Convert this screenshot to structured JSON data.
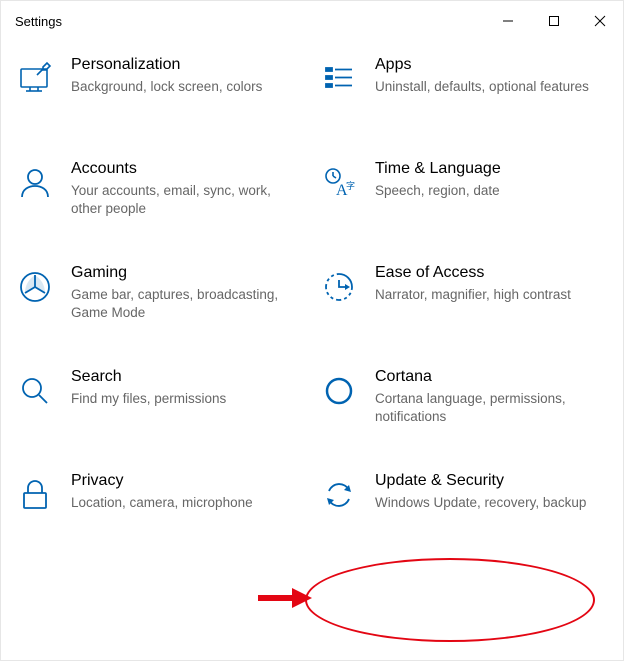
{
  "window": {
    "title": "Settings"
  },
  "categories": [
    {
      "id": "personalization",
      "title": "Personalization",
      "desc": "Background, lock screen, colors",
      "icon": "personalization-icon"
    },
    {
      "id": "apps",
      "title": "Apps",
      "desc": "Uninstall, defaults, optional features",
      "icon": "apps-icon"
    },
    {
      "id": "accounts",
      "title": "Accounts",
      "desc": "Your accounts, email, sync, work, other people",
      "icon": "accounts-icon"
    },
    {
      "id": "time-language",
      "title": "Time & Language",
      "desc": "Speech, region, date",
      "icon": "time-language-icon"
    },
    {
      "id": "gaming",
      "title": "Gaming",
      "desc": "Game bar, captures, broadcasting, Game Mode",
      "icon": "gaming-icon"
    },
    {
      "id": "ease-of-access",
      "title": "Ease of Access",
      "desc": "Narrator, magnifier, high contrast",
      "icon": "ease-of-access-icon"
    },
    {
      "id": "search",
      "title": "Search",
      "desc": "Find my files, permissions",
      "icon": "search-icon"
    },
    {
      "id": "cortana",
      "title": "Cortana",
      "desc": "Cortana language, permissions, notifications",
      "icon": "cortana-icon"
    },
    {
      "id": "privacy",
      "title": "Privacy",
      "desc": "Location, camera, microphone",
      "icon": "privacy-icon"
    },
    {
      "id": "update-security",
      "title": "Update & Security",
      "desc": "Windows Update, recovery, backup",
      "icon": "update-security-icon"
    }
  ],
  "annotations": {
    "circle_target": "update-security",
    "arrow_target": "update-security"
  }
}
